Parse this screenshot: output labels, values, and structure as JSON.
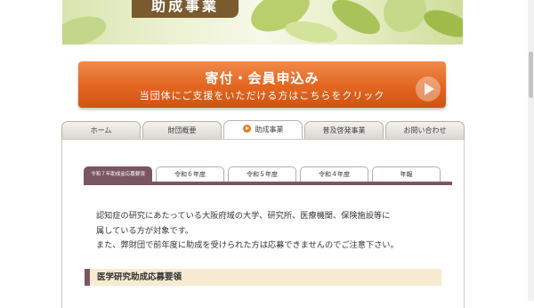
{
  "banner": {
    "title": "助成事業"
  },
  "donate": {
    "main_label": "寄付・会員申込み",
    "sub_label": "当団体にご支援をいただける方はこちらをクリック"
  },
  "nav": {
    "tabs": [
      {
        "label": "ホーム"
      },
      {
        "label": "財団概要"
      },
      {
        "label": "助成事業",
        "active": true
      },
      {
        "label": "普及啓発事業"
      },
      {
        "label": "お問い合わせ"
      }
    ]
  },
  "subtabs": [
    {
      "label": "令和７年助成金応募要領",
      "active": true
    },
    {
      "label": "令和６年度"
    },
    {
      "label": "令和５年度"
    },
    {
      "label": "令和４年度"
    },
    {
      "label": "年報"
    }
  ],
  "intro": {
    "line1": "認知症の研究にあたっている大阪府域の大学、研究所、医療機関、保険施設等に",
    "line2": "属している方が対象です。",
    "line3": "また、弊財団で前年度に助成を受けられた方は応募できませんのでご注意下さい。"
  },
  "section": {
    "heading": "医学研究助成応募要領"
  },
  "colors": {
    "accent": "#e2661f",
    "brand": "#7a5660",
    "heading_bg": "#f6ebd1"
  }
}
